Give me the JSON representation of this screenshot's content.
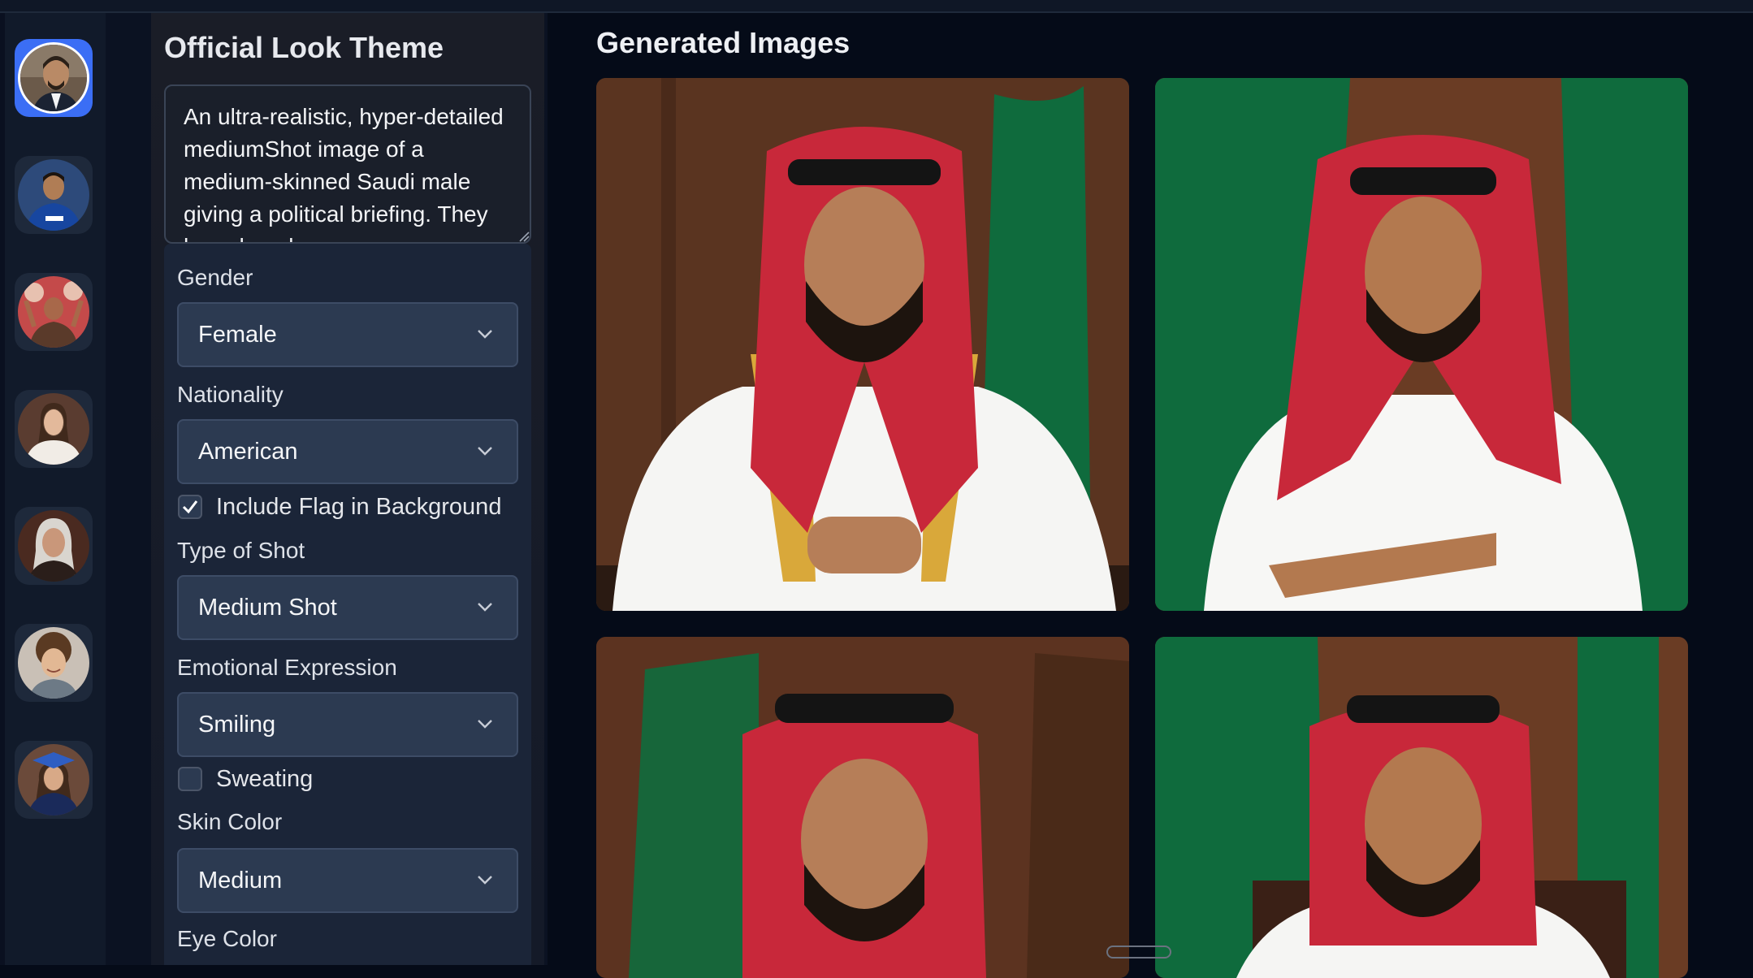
{
  "sidebar": {
    "avatars": [
      {
        "name": "official-look",
        "selected": true
      },
      {
        "name": "football-jersey",
        "selected": false
      },
      {
        "name": "fan-crowd",
        "selected": false
      },
      {
        "name": "bride",
        "selected": false
      },
      {
        "name": "elderly-woman",
        "selected": false
      },
      {
        "name": "child-curly-hair",
        "selected": false
      },
      {
        "name": "graduate",
        "selected": false
      }
    ]
  },
  "panel": {
    "title": "Official Look Theme",
    "prompt": "An ultra-realistic, hyper-detailed mediumShot image of a medium-skinned Saudi male giving a political briefing. They have hazel eyes"
  },
  "form": {
    "gender": {
      "label": "Gender",
      "value": "Female"
    },
    "nationality": {
      "label": "Nationality",
      "value": "American"
    },
    "flag": {
      "label": "Include Flag in Background",
      "checked": true
    },
    "shot": {
      "label": "Type of Shot",
      "value": "Medium Shot"
    },
    "expression": {
      "label": "Emotional Expression",
      "value": "Smiling"
    },
    "sweating": {
      "label": "Sweating",
      "checked": false
    },
    "skin": {
      "label": "Skin Color",
      "value": "Medium"
    },
    "eye": {
      "label": "Eye Color"
    }
  },
  "main": {
    "title": "Generated Images",
    "images": [
      {
        "name": "generated-image-1"
      },
      {
        "name": "generated-image-2"
      },
      {
        "name": "generated-image-3"
      },
      {
        "name": "generated-image-4"
      }
    ]
  },
  "colors": {
    "accent": "#3b6ef5",
    "background": "#050b18",
    "panel": "#1b2538",
    "select": "#2c3a51",
    "flag_green": "#0f6b3d",
    "keffiyeh_red": "#c8283a"
  }
}
